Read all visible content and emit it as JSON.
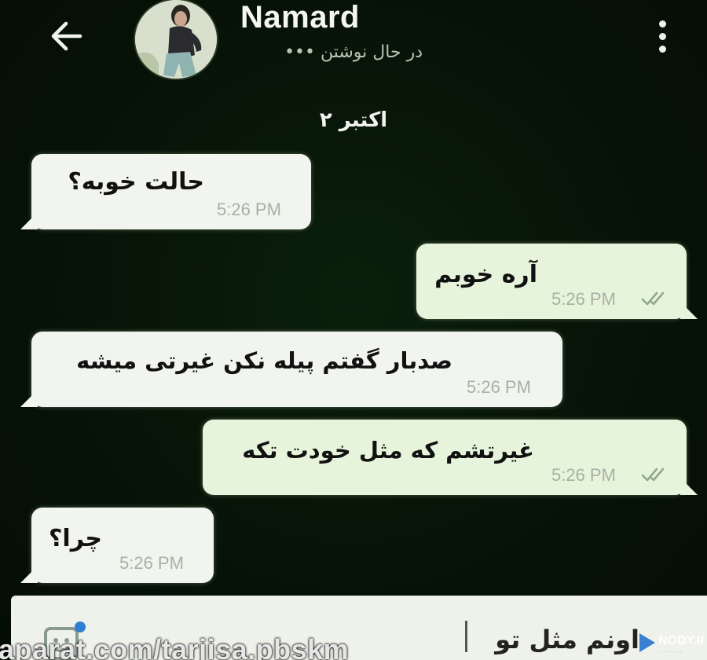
{
  "header": {
    "back_icon": "arrow-left-icon",
    "contact_name": "Namard",
    "status": "در حال نوشتن •••",
    "menu_icon": "more-vertical-icon"
  },
  "date_divider": "اکتبر ۲",
  "messages": [
    {
      "direction": "incoming",
      "text": "حالت خوبه؟",
      "time": "5:26 PM",
      "read": false
    },
    {
      "direction": "outgoing",
      "text": "آره خوبم",
      "time": "5:26 PM",
      "read": true
    },
    {
      "direction": "incoming",
      "text": "صدبار گفتم پیله نکن غیرتی میشه",
      "time": "5:26 PM",
      "read": false
    },
    {
      "direction": "outgoing",
      "text": "غیرتشم که مثل خودت تکه",
      "time": "5:26 PM",
      "read": true
    },
    {
      "direction": "incoming",
      "text": "چرا؟",
      "time": "5:26 PM",
      "read": false
    }
  ],
  "composer": {
    "text": "اونم مثل تو",
    "emoji_icon": "emoji-sticker-icon"
  },
  "watermarks": {
    "aparat": "aparat.com/tarjisa.pbskm",
    "nody": "NODY.IR"
  },
  "colors": {
    "background": "#071307",
    "bubble_incoming": "#f2f5ef",
    "bubble_outgoing": "#e7f4dc",
    "read_tick": "#8fa889"
  }
}
